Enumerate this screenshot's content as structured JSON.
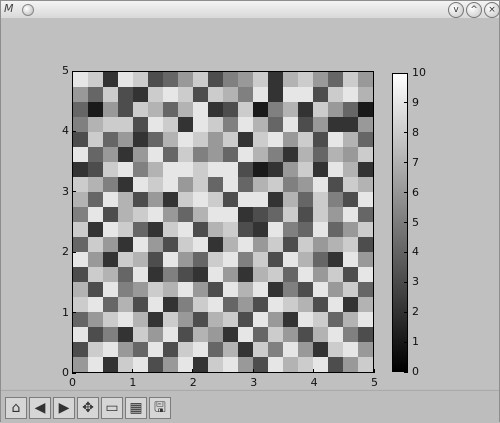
{
  "window": {
    "app_icon": "matplotlib-icon",
    "buttons": [
      "minimize-button",
      "maximize-button",
      "close-button"
    ]
  },
  "chart_data": {
    "type": "heatmap",
    "title": "",
    "xlabel": "",
    "ylabel": "",
    "xlim": [
      0,
      5
    ],
    "ylim": [
      0,
      5
    ],
    "xticks": [
      "0",
      "1",
      "2",
      "3",
      "4",
      "5"
    ],
    "yticks": [
      "0",
      "1",
      "2",
      "3",
      "4",
      "5"
    ],
    "grid": false,
    "colorbar": {
      "range": [
        0,
        10
      ],
      "ticks": [
        "0",
        "1",
        "2",
        "3",
        "4",
        "5",
        "6",
        "7",
        "8",
        "9",
        "10"
      ],
      "colormap": "gray"
    },
    "matrix": [
      [
        9,
        8,
        2,
        9,
        8,
        3,
        4,
        6,
        8,
        3,
        5,
        6,
        8,
        2,
        7,
        8,
        6,
        4,
        8,
        6
      ],
      [
        6,
        4,
        8,
        3,
        2,
        8,
        9,
        8,
        3,
        8,
        7,
        5,
        9,
        2,
        9,
        9,
        3,
        8,
        9,
        7
      ],
      [
        4,
        1,
        6,
        3,
        8,
        7,
        4,
        7,
        9,
        2,
        3,
        8,
        1,
        5,
        7,
        2,
        8,
        6,
        4,
        1
      ],
      [
        5,
        7,
        8,
        8,
        3,
        9,
        8,
        2,
        9,
        8,
        5,
        9,
        7,
        4,
        9,
        3,
        6,
        2,
        2,
        6
      ],
      [
        3,
        8,
        4,
        6,
        2,
        4,
        7,
        9,
        8,
        6,
        8,
        2,
        8,
        9,
        6,
        8,
        3,
        9,
        7,
        4
      ],
      [
        9,
        4,
        6,
        2,
        6,
        9,
        4,
        8,
        5,
        6,
        4,
        9,
        7,
        5,
        2,
        7,
        4,
        7,
        6,
        8
      ],
      [
        2,
        3,
        8,
        9,
        5,
        7,
        9,
        9,
        8,
        9,
        9,
        3,
        1,
        2,
        6,
        8,
        2,
        9,
        7,
        2
      ],
      [
        8,
        7,
        5,
        2,
        9,
        8,
        9,
        6,
        8,
        4,
        9,
        4,
        7,
        8,
        5,
        6,
        9,
        3,
        8,
        7
      ],
      [
        7,
        4,
        9,
        7,
        3,
        6,
        2,
        8,
        9,
        8,
        3,
        9,
        9,
        2,
        7,
        4,
        8,
        5,
        3,
        9
      ],
      [
        5,
        9,
        3,
        7,
        8,
        9,
        6,
        4,
        7,
        9,
        9,
        2,
        3,
        4,
        8,
        3,
        8,
        6,
        9,
        4
      ],
      [
        8,
        2,
        9,
        8,
        4,
        2,
        8,
        9,
        3,
        7,
        8,
        3,
        2,
        9,
        5,
        4,
        9,
        4,
        6,
        8
      ],
      [
        4,
        8,
        6,
        2,
        9,
        6,
        3,
        8,
        9,
        2,
        7,
        9,
        6,
        8,
        3,
        8,
        6,
        7,
        8,
        3
      ],
      [
        9,
        6,
        2,
        8,
        7,
        3,
        9,
        6,
        4,
        8,
        9,
        5,
        8,
        3,
        9,
        7,
        4,
        2,
        9,
        6
      ],
      [
        3,
        8,
        7,
        4,
        9,
        2,
        5,
        3,
        2,
        9,
        6,
        2,
        7,
        8,
        4,
        9,
        6,
        8,
        3,
        9
      ],
      [
        7,
        3,
        9,
        5,
        6,
        8,
        7,
        9,
        6,
        3,
        9,
        7,
        9,
        2,
        5,
        3,
        9,
        6,
        8,
        4
      ],
      [
        8,
        9,
        4,
        7,
        3,
        9,
        2,
        5,
        8,
        9,
        4,
        6,
        3,
        9,
        8,
        7,
        3,
        9,
        2,
        7
      ],
      [
        4,
        6,
        8,
        9,
        7,
        2,
        8,
        6,
        3,
        7,
        8,
        3,
        9,
        6,
        2,
        9,
        8,
        4,
        7,
        9
      ],
      [
        9,
        3,
        5,
        2,
        8,
        6,
        9,
        3,
        7,
        6,
        2,
        9,
        4,
        8,
        6,
        3,
        7,
        9,
        5,
        3
      ],
      [
        3,
        8,
        9,
        6,
        4,
        9,
        3,
        8,
        9,
        4,
        7,
        2,
        8,
        5,
        9,
        6,
        2,
        8,
        9,
        6
      ],
      [
        6,
        9,
        2,
        8,
        9,
        3,
        6,
        9,
        2,
        8,
        9,
        6,
        3,
        9,
        7,
        8,
        9,
        3,
        6,
        8
      ]
    ]
  },
  "toolbar": {
    "tools": [
      {
        "name": "home-button",
        "icon": "home-icon",
        "glyph": "⌂"
      },
      {
        "name": "back-button",
        "icon": "back-arrow-icon",
        "glyph": "◀"
      },
      {
        "name": "forward-button",
        "icon": "forward-arrow-icon",
        "glyph": "▶"
      },
      {
        "name": "pan-button",
        "icon": "pan-icon",
        "glyph": "✥"
      },
      {
        "name": "zoom-button",
        "icon": "zoom-rectangle-icon",
        "glyph": "▭"
      },
      {
        "name": "subplots-button",
        "icon": "subplots-icon",
        "glyph": "▦"
      },
      {
        "name": "save-button",
        "icon": "save-icon",
        "glyph": "🖫"
      }
    ]
  }
}
